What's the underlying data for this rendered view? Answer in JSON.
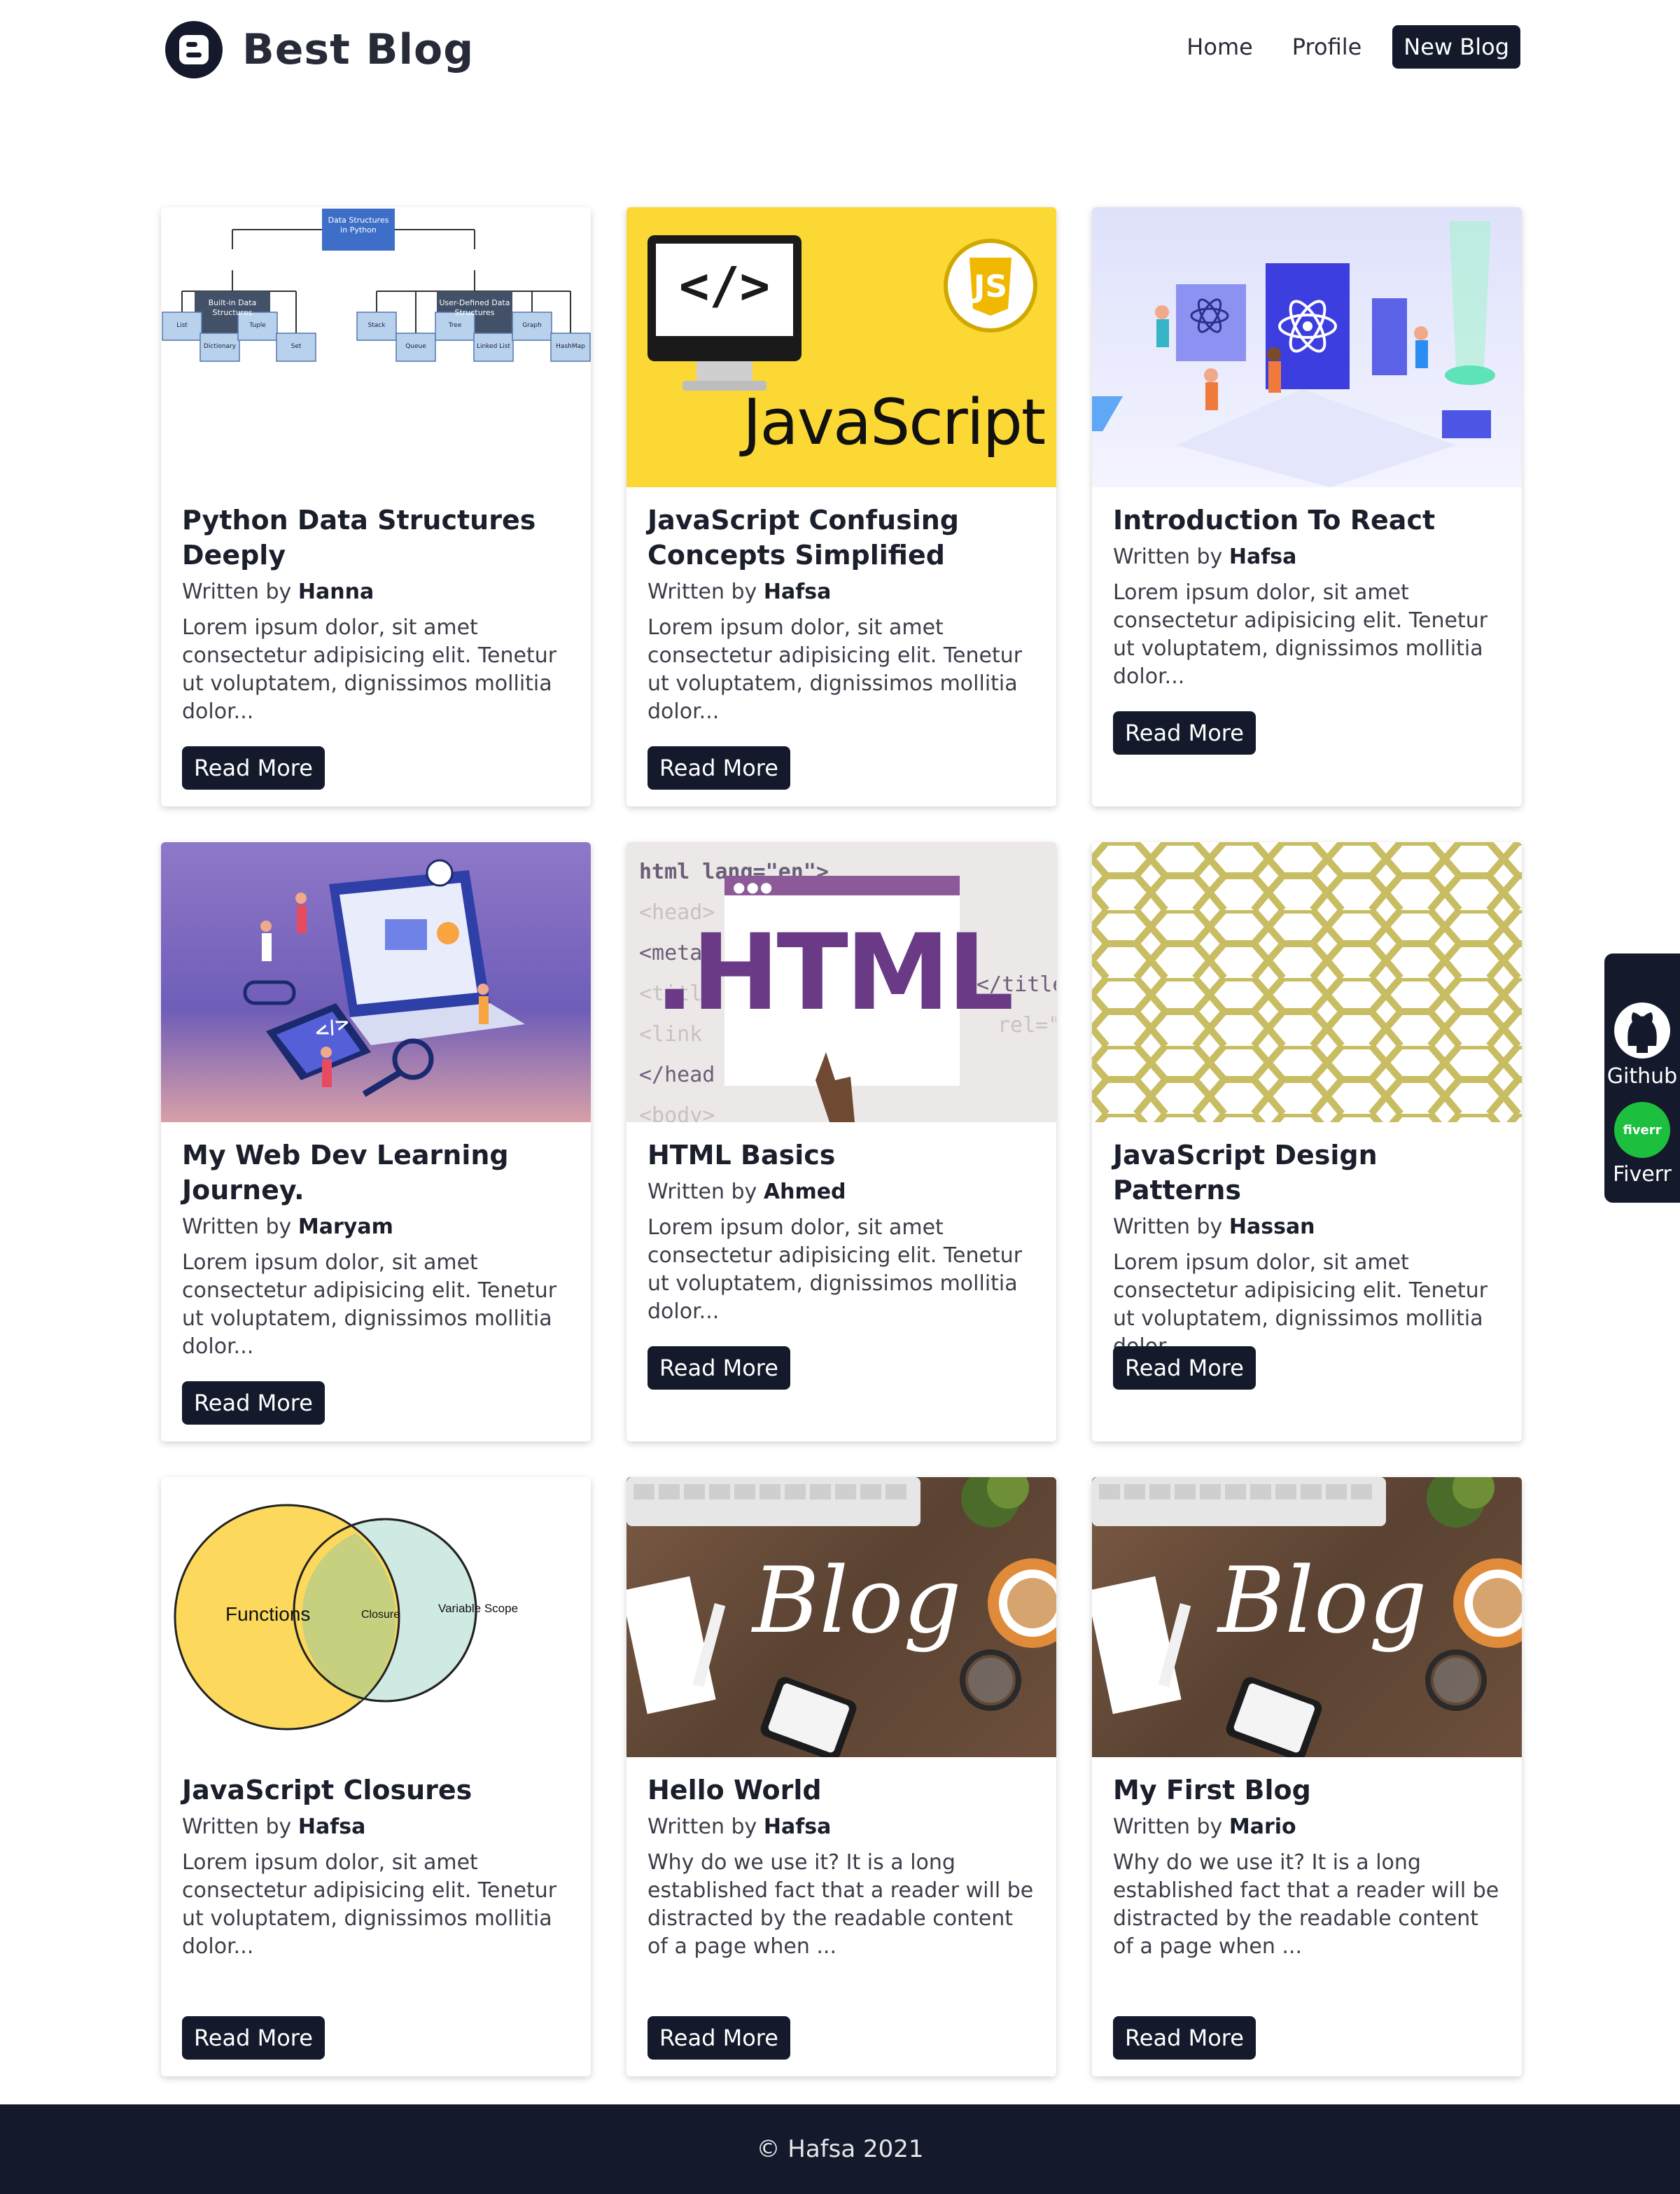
{
  "brand": {
    "title": "Best Blog",
    "logo_icon": "blogger-icon"
  },
  "nav": {
    "home": "Home",
    "profile": "Profile",
    "new_blog": "New Blog"
  },
  "colors": {
    "primary": "#141a2b",
    "fiverr": "#1dbf3e",
    "js_yellow": "#fcd835",
    "olive": "#c8bd62"
  },
  "posts": [
    {
      "title": "Python Data Structures Deeply",
      "by": "Written by",
      "author": "Hanna",
      "excerpt": "Lorem ipsum dolor, sit amet consectetur adipisicing elit. Tenetur ut voluptatem, dignissimos mollitia dolor...",
      "button": "Read More",
      "image": {
        "root": "Data Structures in Python",
        "left": "Built-in Data Structures",
        "right": "User-Defined Data Structures",
        "leaves_left": [
          "List",
          "Dictionary",
          "Tuple",
          "Set"
        ],
        "leaves_right": [
          "Stack",
          "Queue",
          "Tree",
          "Linked List",
          "Graph",
          "HashMap"
        ]
      }
    },
    {
      "title": "JavaScript Confusing Concepts Simplified",
      "by": "Written by",
      "author": "Hafsa",
      "excerpt": "Lorem ipsum dolor, sit amet consectetur adipisicing elit. Tenetur ut voluptatem, dignissimos mollitia dolor...",
      "button": "Read More",
      "image": {
        "code": "</>",
        "word": "JavaScript",
        "badge": "JS"
      }
    },
    {
      "title": "Introduction To React",
      "by": "Written by",
      "author": "Hafsa",
      "excerpt": "Lorem ipsum dolor, sit amet consectetur adipisicing elit. Tenetur ut voluptatem, dignissimos mollitia dolor...",
      "button": "Read More",
      "image": {}
    },
    {
      "title": "My Web Dev Learning Journey.",
      "by": "Written by",
      "author": "Maryam",
      "excerpt": "Lorem ipsum dolor, sit amet consectetur adipisicing elit. Tenetur ut voluptatem, dignissimos mollitia dolor...",
      "button": "Read More",
      "image": {
        "code": "</>"
      }
    },
    {
      "title": "HTML Basics",
      "by": "Written by",
      "author": "Ahmed",
      "excerpt": "Lorem ipsum dolor, sit amet consectetur adipisicing elit. Tenetur ut voluptatem, dignissimos mollitia dolor...",
      "button": "Read More",
      "image": {
        "word": ".HTML",
        "lines": [
          "html lang=\"en\">",
          "<head>",
          "<meta",
          "<titl",
          "<link",
          "</head",
          "<body>"
        ],
        "right_lines": [
          "</title",
          "rel=\""
        ]
      }
    },
    {
      "title": "JavaScript Design Patterns",
      "by": "Written by",
      "author": "Hassan",
      "excerpt": "Lorem ipsum dolor, sit amet consectetur adipisicing elit. Tenetur ut voluptatem, dignissimos mollitia dolor...",
      "button": "Read More",
      "image": {}
    },
    {
      "title": "JavaScript Closures",
      "by": "Written by",
      "author": "Hafsa",
      "excerpt": "Lorem ipsum dolor, sit amet consectetur adipisicing elit. Tenetur ut voluptatem, dignissimos mollitia dolor...",
      "button": "Read More",
      "image": {
        "left": "Functions",
        "middle": "Closure",
        "right": "Variable Scope"
      }
    },
    {
      "title": "Hello World",
      "by": "Written by",
      "author": "Hafsa",
      "excerpt": "Why do we use it? It is a long established fact that a reader will be distracted by the readable content of a page when ...",
      "button": "Read More",
      "image": {
        "word": "Blog"
      }
    },
    {
      "title": "My First Blog",
      "by": "Written by",
      "author": "Mario",
      "excerpt": "Why do we use it? It is a long established fact that a reader will be distracted by the readable content of a page when ...",
      "button": "Read More",
      "image": {
        "word": "Blog"
      }
    }
  ],
  "side": {
    "github_label": "Github",
    "github_icon": "github-icon",
    "fiverr_label": "Fiverr",
    "fiverr_badge": "fiverr",
    "fiverr_icon": "fiverr-icon"
  },
  "footer": {
    "text": "© Hafsa 2021"
  }
}
